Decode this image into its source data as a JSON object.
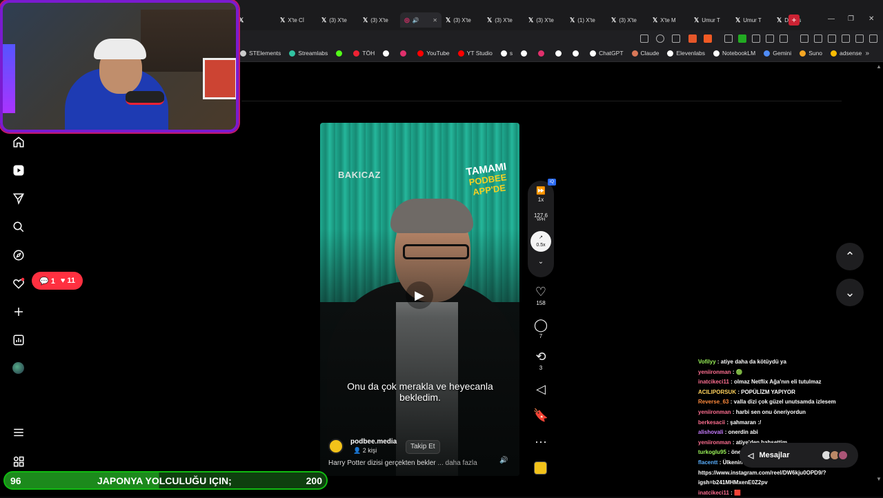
{
  "browser": {
    "tabs": [
      {
        "label": "",
        "active": false
      },
      {
        "label": "X'te Cİ",
        "active": false
      },
      {
        "label": "(3) X'te",
        "active": false
      },
      {
        "label": "(3) X'te",
        "active": false
      },
      {
        "label": "",
        "active": true
      },
      {
        "label": "(3) X'te",
        "active": false
      },
      {
        "label": "(3) X'te",
        "active": false
      },
      {
        "label": "(3) X'te",
        "active": false
      },
      {
        "label": "(1) X'te",
        "active": false
      },
      {
        "label": "(3) X'te",
        "active": false
      },
      {
        "label": "X'te M",
        "active": false
      },
      {
        "label": "Umur T",
        "active": false
      },
      {
        "label": "Umur T",
        "active": false
      },
      {
        "label": "Discus",
        "active": false
      }
    ],
    "new_tab": "+",
    "bookmarks": [
      {
        "label": "STElements",
        "color": "#cccccc"
      },
      {
        "label": "Streamlabs",
        "color": "#31c3a2"
      },
      {
        "label": "",
        "color": "#53fc18"
      },
      {
        "label": "TÖH",
        "color": "#e23"
      },
      {
        "label": "",
        "color": "#ffffff"
      },
      {
        "label": "",
        "color": "#e1306c"
      },
      {
        "label": "YouTube",
        "color": "#ff0000"
      },
      {
        "label": "YT Studio",
        "color": "#ff0000"
      },
      {
        "label": "s",
        "color": "#ffffff"
      },
      {
        "label": "",
        "color": "#ffffff"
      },
      {
        "label": "",
        "color": "#e1306c"
      },
      {
        "label": "",
        "color": "#ffffff"
      },
      {
        "label": "",
        "color": "#ffffff"
      },
      {
        "label": "ChatGPT",
        "color": "#ffffff"
      },
      {
        "label": "Claude",
        "color": "#d97757"
      },
      {
        "label": "Elevenlabs",
        "color": "#ffffff"
      },
      {
        "label": "NotebookLM",
        "color": "#ffffff"
      },
      {
        "label": "Gemini",
        "color": "#4f8cf7"
      },
      {
        "label": "Suno",
        "color": "#f5a623"
      },
      {
        "label": "adsense",
        "color": "#fbbc04"
      }
    ]
  },
  "sidebar": {
    "notifications": {
      "comments": "1",
      "likes": "11"
    }
  },
  "reel": {
    "brand_text": "BAKICAZ",
    "promo_line1": "TAMAMI",
    "promo_line2": "PODBEE",
    "promo_line3": "APP'DE",
    "subtitle": "Onu da çok merakla ve heyecanla bekledim.",
    "username": "podbee.media",
    "people": "2 kişi",
    "follow_label": "Takip Et",
    "caption": "Harry Potter dizisi gerçekten bekler",
    "caption_more": "... daha fazla"
  },
  "speed_controller": {
    "speed": "1x",
    "vph_value": "127.6",
    "vph_label": "VPH",
    "ratio": "0.5x",
    "badge": "iQ"
  },
  "actions": {
    "likes": "158",
    "comments": "7",
    "reposts": "3"
  },
  "chat": [
    {
      "user": "Vofilyy",
      "color": "#9cf55a",
      "text": ": atiye daha da kötüydü ya"
    },
    {
      "user": "yeniironman",
      "color": "#ff6f91",
      "text": ": 🟢"
    },
    {
      "user": "inatcikeci11",
      "color": "#ff6f91",
      "text": ": olmaz Netflix Ağa'nın eli tutulmaz"
    },
    {
      "user": "ACILIPORSUK",
      "color": "#ffd15c",
      "text": ": POPÜLİZM YAPIYOR"
    },
    {
      "user": "Reverse_63",
      "color": "#ff8a3d",
      "text": ": valla dizi çok güzel unutsamda izlesem"
    },
    {
      "user": "yeniironman",
      "color": "#ff6f91",
      "text": ": harbi sen onu öneriyordun"
    },
    {
      "user": "berkesacii",
      "color": "#ff6f91",
      "text": ": şahmaran :/"
    },
    {
      "user": "alishovali",
      "color": "#c77dff",
      "text": ": onerdin abi"
    },
    {
      "user": "yeniironman",
      "color": "#ff6f91",
      "text": ": atiye'den bahsettim"
    },
    {
      "user": "turkoglu95",
      "color": "#9cf55a",
      "text": ": öner"
    },
    {
      "user": "flacentt",
      "color": "#5ab0ff",
      "text": ": Ülkenin ortalama sinema bilgisi 😂😂"
    },
    {
      "user": "",
      "color": "#ffffff",
      "text": "https://www.instagram.com/reel/DW6kju0OPD9/?"
    },
    {
      "user": "",
      "color": "#ffffff",
      "text": "igsh=b241MHMxenE0Z2pv"
    },
    {
      "user": "inatcikeci11",
      "color": "#ff6f91",
      "text": ": 🟥"
    }
  ],
  "messages": {
    "label": "Mesajlar"
  },
  "goal": {
    "current": "96",
    "title": "JAPONYA YOLCULUĞU IÇIN;",
    "target": "200",
    "progress": 0.48
  }
}
